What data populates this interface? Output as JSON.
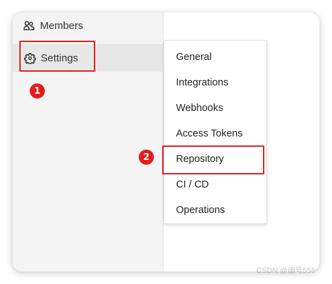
{
  "sidebar": {
    "members": {
      "label": "Members",
      "icon": "members-icon"
    },
    "settings": {
      "label": "Settings",
      "icon": "gear-icon"
    }
  },
  "flyout": {
    "items": [
      {
        "label": "General"
      },
      {
        "label": "Integrations"
      },
      {
        "label": "Webhooks"
      },
      {
        "label": "Access Tokens"
      },
      {
        "label": "Repository"
      },
      {
        "label": "CI / CD"
      },
      {
        "label": "Operations"
      }
    ]
  },
  "annotations": {
    "step1": "1",
    "step2": "2",
    "highlight_color": "#e0201e"
  },
  "watermark": "CSDN @编号555"
}
